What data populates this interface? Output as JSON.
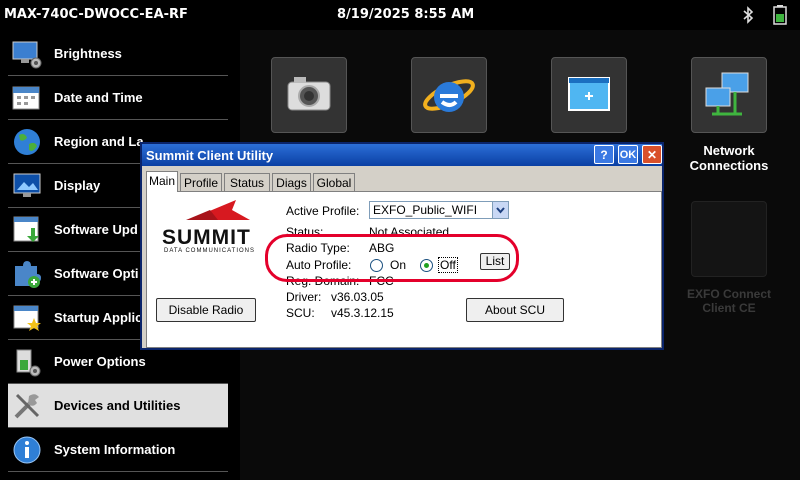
{
  "status_bar": {
    "device_name": "MAX-740C-DWOCC-EA-RF",
    "datetime": "8/19/2025 8:55 AM"
  },
  "sidebar": {
    "items": [
      {
        "label": "Brightness",
        "icon": "monitor-gear-icon"
      },
      {
        "label": "Date and Time",
        "icon": "calendar-icon"
      },
      {
        "label": "Region and La",
        "icon": "globe-icon"
      },
      {
        "label": "Display",
        "icon": "display-icon"
      },
      {
        "label": "Software Upd",
        "icon": "software-update-icon"
      },
      {
        "label": "Software Opti",
        "icon": "puzzle-icon"
      },
      {
        "label": "Startup Applic",
        "icon": "startup-icon"
      },
      {
        "label": "Power Options",
        "icon": "power-gear-icon"
      },
      {
        "label": "Devices and Utilities",
        "icon": "tools-icon",
        "selected": true
      },
      {
        "label": "System Information",
        "icon": "info-icon"
      }
    ]
  },
  "desktop": {
    "network_label_line1": "Network",
    "network_label_line2": "Connections",
    "exfo_label_line1": "EXFO Connect",
    "exfo_label_line2": "Client CE"
  },
  "dialog": {
    "title": "Summit Client Utility",
    "help_label": "?",
    "ok_label": "OK",
    "close_label": "✕",
    "tabs": [
      "Main",
      "Profile",
      "Status",
      "Diags",
      "Global"
    ],
    "active_tab": "Main",
    "logo_text": "SUMMIT",
    "logo_subtext": "DATA COMMUNICATIONS",
    "active_profile_label": "Active Profile:",
    "active_profile_value": "EXFO_Public_WIFI",
    "status_label": "Status:",
    "status_value": "Not Associated",
    "radio_type_label": "Radio Type:",
    "radio_type_value": "ABG",
    "auto_profile_label": "Auto Profile:",
    "auto_profile_on": "On",
    "auto_profile_off": "Off",
    "auto_profile_selected": "Off",
    "list_button": "List",
    "reg_domain_label": "Reg. Domain:",
    "reg_domain_value": "FCC",
    "driver_label": "Driver:",
    "driver_value": "v36.03.05",
    "scu_label": "SCU:",
    "scu_value": "v45.3.12.15",
    "disable_radio_button": "Disable Radio",
    "about_button": "About SCU"
  },
  "colors": {
    "title_bar": "#0a3fa3",
    "highlight": "#e4002b",
    "logo_red": "#d71920"
  }
}
